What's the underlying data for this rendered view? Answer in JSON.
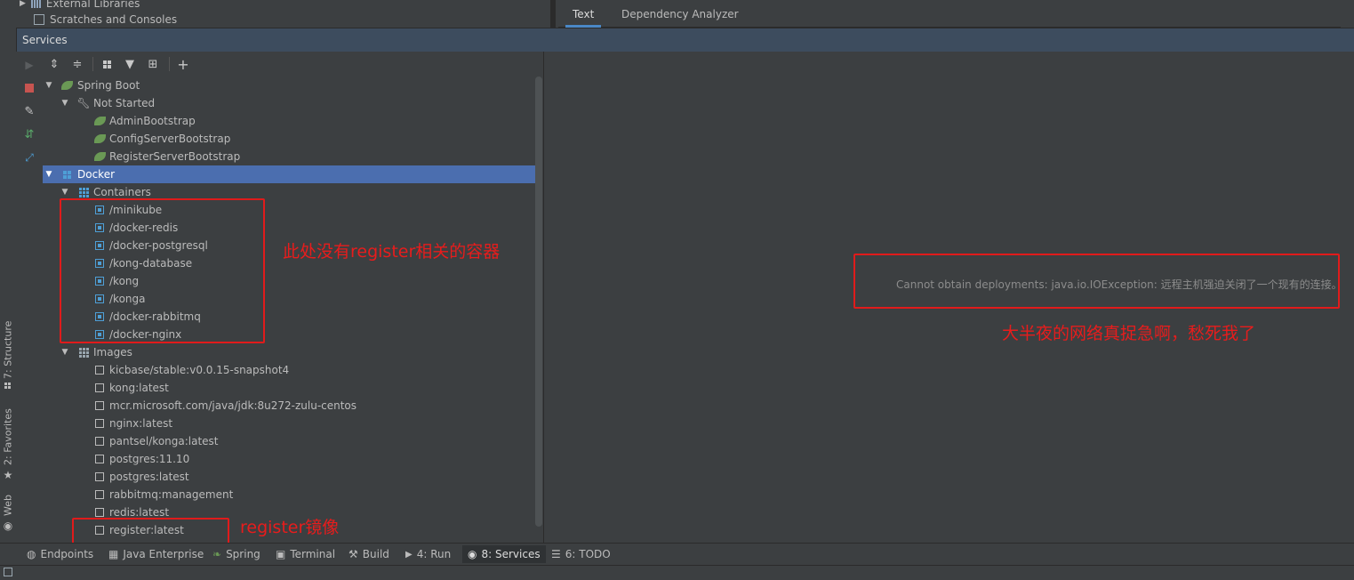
{
  "top_tree": {
    "items": [
      {
        "label": "External Libraries",
        "icon": "library-icon"
      },
      {
        "label": "Scratches and Consoles",
        "icon": "scratches-icon"
      }
    ]
  },
  "editor_tabs": [
    {
      "label": "Text",
      "active": true
    },
    {
      "label": "Dependency Analyzer",
      "active": false
    }
  ],
  "services": {
    "title": "Services",
    "toolbar": [
      "expand-all-icon",
      "collapse-all-icon",
      "group-by-icon",
      "filter-icon",
      "new-tab-icon",
      "add-icon"
    ],
    "actions": [
      "run-icon",
      "stop-icon",
      "edit-icon",
      "deploy-icon",
      "redeploy-icon"
    ]
  },
  "tree": {
    "spring_boot": {
      "label": "Spring Boot",
      "not_started": {
        "label": "Not Started",
        "apps": [
          "AdminBootstrap",
          "ConfigServerBootstrap",
          "RegisterServerBootstrap"
        ]
      }
    },
    "docker": {
      "label": "Docker",
      "containers": {
        "label": "Containers",
        "items": [
          "/minikube",
          "/docker-redis",
          "/docker-postgresql",
          "/kong-database",
          "/kong",
          "/konga",
          "/docker-rabbitmq",
          "/docker-nginx"
        ]
      },
      "images": {
        "label": "Images",
        "items": [
          "kicbase/stable:v0.0.15-snapshot4",
          "kong:latest",
          "mcr.microsoft.com/java/jdk:8u272-zulu-centos",
          "nginx:latest",
          "pantsel/konga:latest",
          "postgres:11.10",
          "postgres:latest",
          "rabbitmq:management",
          "redis:latest",
          "register:latest"
        ]
      }
    }
  },
  "right_panel": {
    "error": "Cannot obtain deployments: java.io.IOException: 远程主机强迫关闭了一个现有的连接。"
  },
  "annotations": {
    "containers_note": "此处没有register相关的容器",
    "error_note": "大半夜的网络真捉急啊，愁死我了",
    "image_note": "register镜像",
    "color": "#e01b1b"
  },
  "left_stripe": [
    {
      "label": "7: Structure"
    },
    {
      "label": "2: Favorites"
    },
    {
      "label": "Web"
    }
  ],
  "bottom_tabs": [
    {
      "label": "Endpoints",
      "icon": "endpoints-icon"
    },
    {
      "label": "Java Enterprise",
      "icon": "java-enterprise-icon"
    },
    {
      "label": "Spring",
      "icon": "spring-icon"
    },
    {
      "label": "Terminal",
      "icon": "terminal-icon"
    },
    {
      "label": "Build",
      "icon": "build-icon"
    },
    {
      "label": "4: Run",
      "icon": "run-icon"
    },
    {
      "label": "8: Services",
      "icon": "services-icon",
      "active": true
    },
    {
      "label": "6: TODO",
      "icon": "todo-icon"
    }
  ],
  "colors": {
    "background": "#3c3f41",
    "selection": "#4b6eaf",
    "header": "#3d4c5e",
    "accent": "#4e9fd6"
  }
}
